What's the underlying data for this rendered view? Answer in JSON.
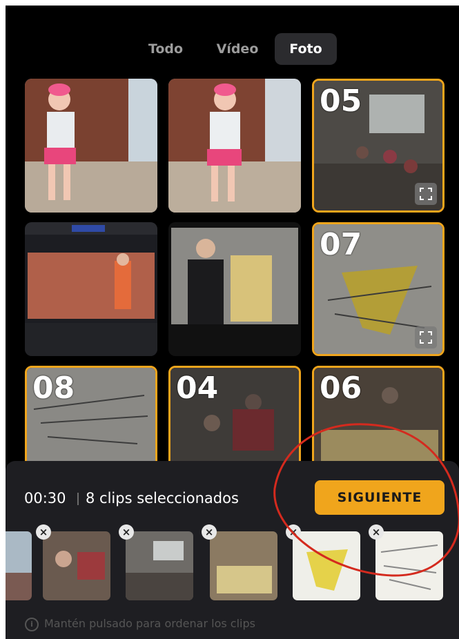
{
  "tabs": [
    {
      "label": "Todo"
    },
    {
      "label": "Vídeo"
    },
    {
      "label": "Foto"
    }
  ],
  "active_tab": "Foto",
  "grid": [
    {
      "number": ""
    },
    {
      "number": ""
    },
    {
      "number": "05"
    },
    {
      "number": ""
    },
    {
      "number": ""
    },
    {
      "number": "07"
    },
    {
      "number": "08"
    },
    {
      "number": "04"
    },
    {
      "number": "06"
    }
  ],
  "selection": {
    "duration": "00:30",
    "count_text": "8 clips seleccionados",
    "next_label": "SIGUIENTE"
  },
  "hint": "Mantén pulsado para ordenar los clips",
  "colors": {
    "accent": "#f0a51c",
    "background": "#000000",
    "panel": "#1e1e22",
    "annotation": "#d42a1e"
  },
  "icons": [
    "expand-icon",
    "close-icon",
    "info-icon"
  ]
}
